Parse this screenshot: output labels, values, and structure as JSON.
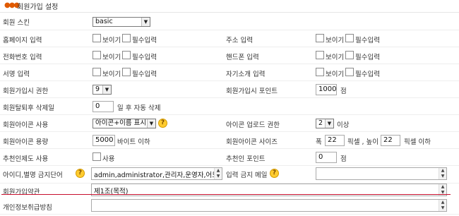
{
  "header": {
    "title": "회원가입 설정"
  },
  "skin": {
    "label": "회원 스킨",
    "value": "basic"
  },
  "checkbox_texts": {
    "show": "보이기",
    "required": "필수입력"
  },
  "homepage": {
    "label": "홈페이지 입력"
  },
  "address": {
    "label": "주소 입력"
  },
  "phone": {
    "label": "전화번호 입력"
  },
  "mobile": {
    "label": "핸드폰 입력"
  },
  "signature": {
    "label": "서명 입력"
  },
  "profile": {
    "label": "자기소개 입력"
  },
  "level": {
    "label": "회원가입시 권한",
    "value": "9"
  },
  "point": {
    "label": "회원가입시 포인트",
    "value": "1000",
    "unit": "점"
  },
  "leave_delete": {
    "label": "회원탈퇴후 삭제일",
    "value": "0",
    "suffix": "일 후 자동 삭제"
  },
  "icon_use": {
    "label": "회원아이콘 사용",
    "value": "아이콘+이름 표시"
  },
  "icon_upload_level": {
    "label": "아이콘 업로드 권한",
    "value": "2",
    "suffix": "이상"
  },
  "icon_size": {
    "label": "회원아이콘 용량",
    "value": "5000",
    "suffix": "바이트 이하"
  },
  "icon_dimensions": {
    "label": "회원아이콘 사이즈",
    "width_label": "폭",
    "width": "22",
    "height_label": "픽셀 , 높이",
    "height": "22",
    "suffix": "픽셀 이하"
  },
  "recommend_use": {
    "label": "추천인제도 사용",
    "checkbox_label": "사용"
  },
  "recommend_point": {
    "label": "추천인 포인트",
    "value": "0",
    "unit": "점"
  },
  "prohibit_id": {
    "label": "아이디,별명 금지단어",
    "value": "admin,administrator,관리자,운영자,어드"
  },
  "prohibit_email": {
    "label": "입력 금지 메일"
  },
  "stipulation": {
    "label": "회원가입약관",
    "value": "제1조(목적)"
  },
  "privacy": {
    "label": "개인정보취급방침"
  },
  "colors": {
    "accent_line": "#c8102e",
    "help_icon": "#ffcb2f",
    "header_dots": "#e05a00"
  }
}
